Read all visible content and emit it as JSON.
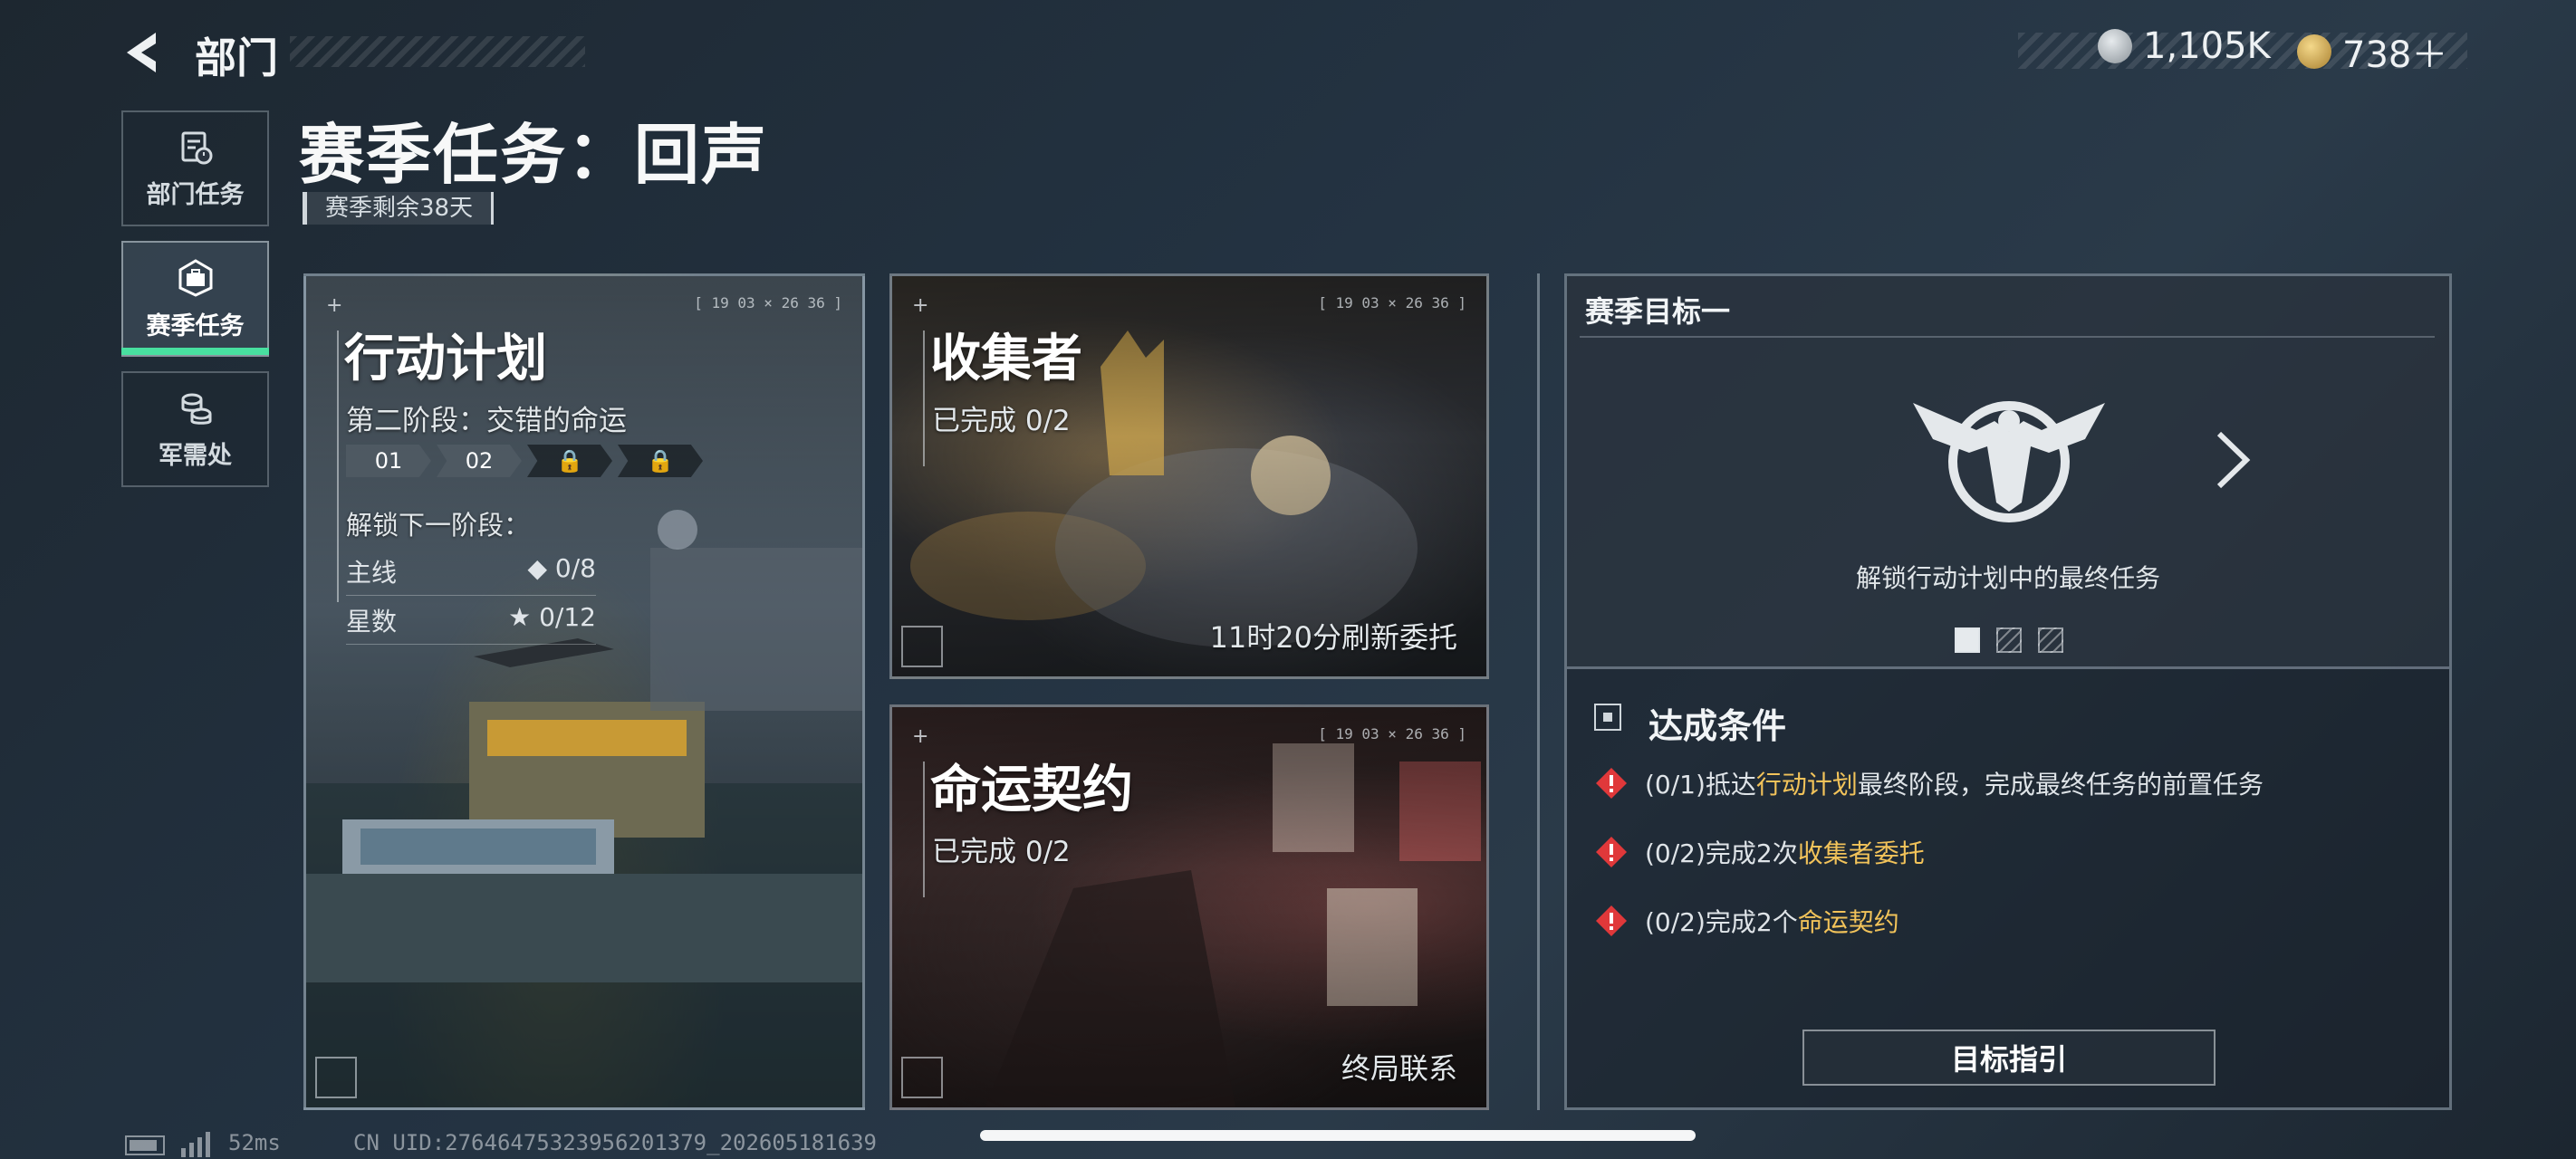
{
  "header": {
    "back_label": "部门",
    "currency": [
      {
        "icon": "silver-coin-icon",
        "value": "1,105K",
        "color": "#b9c0c6"
      },
      {
        "icon": "gold-triangle-coin-icon",
        "value": "738＋",
        "color": "#d8b45a"
      }
    ]
  },
  "sidebar": {
    "items": [
      {
        "label": "部门任务",
        "icon": "clipboard-clock-icon"
      },
      {
        "label": "赛季任务",
        "icon": "briefcase-icon"
      },
      {
        "label": "军需处",
        "icon": "coin-stack-icon"
      }
    ],
    "active_index": 1,
    "accent": "#48e0a0"
  },
  "page": {
    "title": "赛季任务：回声",
    "remaining": "赛季剩余38天"
  },
  "cards": {
    "plan": {
      "title": "行动计划",
      "stage_text": "第二阶段：交错的命运",
      "stages": [
        "01",
        "02",
        "🔒",
        "🔒"
      ],
      "unlock_label": "解锁下一阶段：",
      "rows": [
        {
          "label": "主线",
          "value": "◆ 0/8"
        },
        {
          "label": "星数",
          "value": "★ 0/12"
        }
      ]
    },
    "collector": {
      "title": "收集者",
      "progress": "已完成 0/2",
      "footer": "11时20分刷新委托"
    },
    "contract": {
      "title": "命运契约",
      "progress": "已完成 0/2",
      "footer": "终局联系"
    }
  },
  "goal": {
    "heading": "赛季目标一",
    "description": "解锁行动计划中的最终任务",
    "conditions_title": "达成条件",
    "conditions": [
      {
        "prefix": "(0/1)抵达",
        "highlight": "行动计划",
        "suffix": "最终阶段，完成最终任务的前置任务"
      },
      {
        "prefix": "(0/2)完成2次",
        "highlight": "收集者委托",
        "suffix": ""
      },
      {
        "prefix": "(0/2)完成2个",
        "highlight": "命运契约",
        "suffix": ""
      }
    ],
    "guide_button": "目标指引",
    "warn_color": "#e0383a",
    "highlight_color": "#f2c35a"
  },
  "status_bar": {
    "ping": "52ms",
    "uid": "CN UID:2764647532395620137​9_202605181639"
  }
}
